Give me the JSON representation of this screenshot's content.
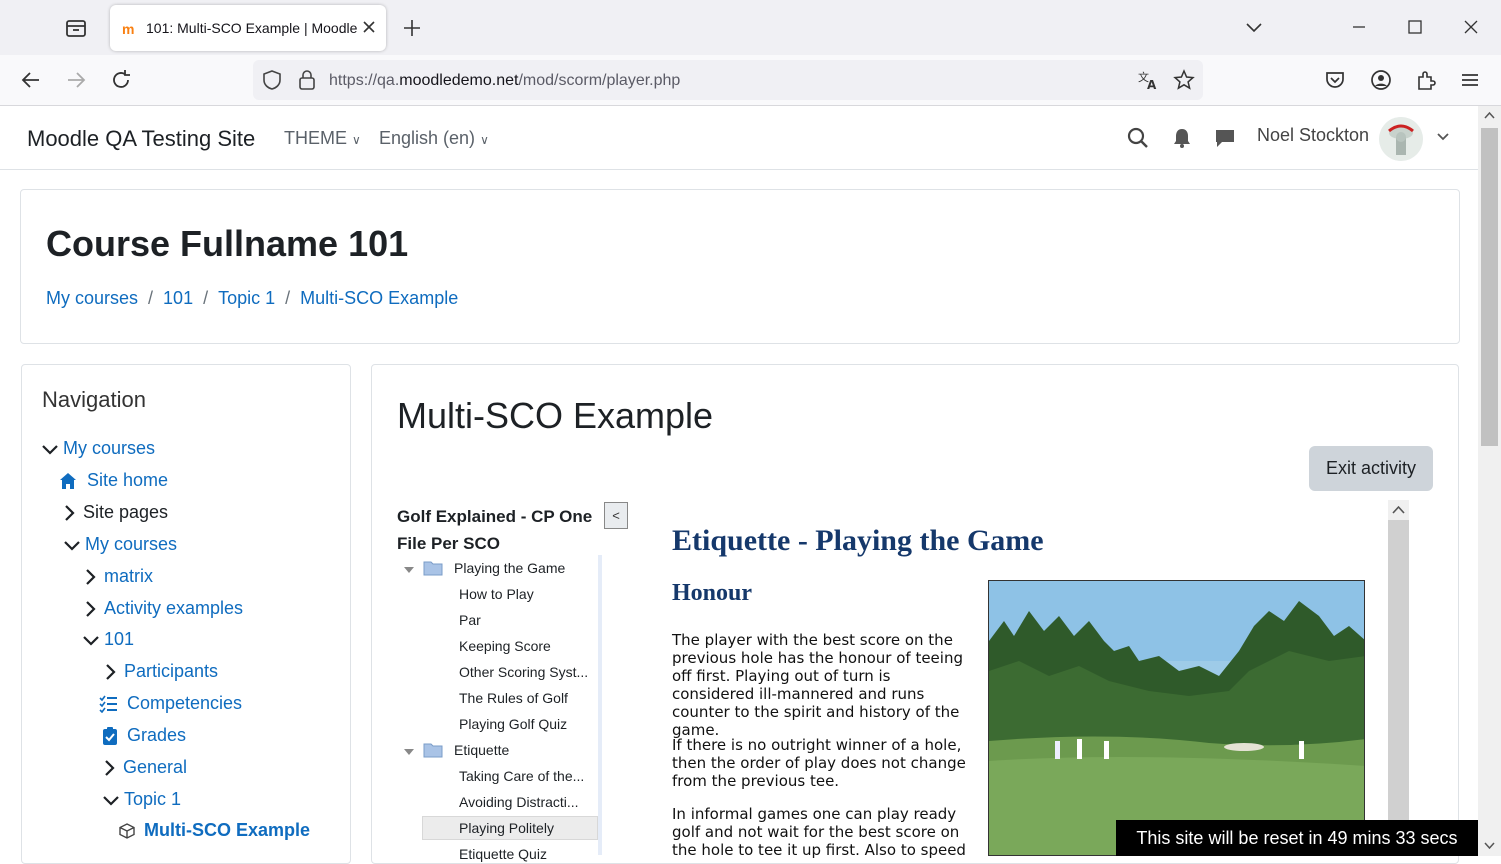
{
  "browser": {
    "tab_title": "101: Multi-SCO Example | Moodle",
    "url_prefix": "https://qa.",
    "url_domain": "moodledemo.net",
    "url_path": "/mod/scorm/player.php"
  },
  "header": {
    "site_name": "Moodle QA Testing Site",
    "theme_label": "THEME",
    "language_label": "English (en)",
    "user_name": "Noel Stockton"
  },
  "page": {
    "course_title": "Course Fullname 101",
    "breadcrumb": [
      "My courses",
      "101",
      "Topic 1",
      "Multi-SCO Example"
    ]
  },
  "navigation": {
    "heading": "Navigation",
    "items": [
      {
        "label": "My courses"
      },
      {
        "label": "Site home"
      },
      {
        "label": "Site pages"
      },
      {
        "label": "My courses"
      },
      {
        "label": "matrix"
      },
      {
        "label": "Activity examples"
      },
      {
        "label": "101"
      },
      {
        "label": "Participants"
      },
      {
        "label": "Competencies"
      },
      {
        "label": "Grades"
      },
      {
        "label": "General"
      },
      {
        "label": "Topic 1"
      },
      {
        "label": "Multi-SCO Example"
      }
    ]
  },
  "main": {
    "activity_title": "Multi-SCO Example",
    "exit_button": "Exit activity",
    "toc_title": "Golf Explained - CP One File Per SCO",
    "toc_toggle": "<",
    "toc": [
      {
        "label": "Playing the Game"
      },
      {
        "label": "How to Play"
      },
      {
        "label": "Par"
      },
      {
        "label": "Keeping Score"
      },
      {
        "label": "Other Scoring Syst..."
      },
      {
        "label": "The Rules of Golf"
      },
      {
        "label": "Playing Golf Quiz"
      },
      {
        "label": "Etiquette"
      },
      {
        "label": "Taking Care of the..."
      },
      {
        "label": "Avoiding Distracti..."
      },
      {
        "label": "Playing Politely"
      },
      {
        "label": "Etiquette Quiz"
      }
    ]
  },
  "sco": {
    "heading": "Etiquette - Playing the Game",
    "subheading": "Honour",
    "paragraphs": [
      "The player with the best score on the previous hole has the honour of teeing off first. Playing out of turn is considered ill-mannered and runs counter to the spirit and history of the game.",
      "If there is no outright winner of a hole, then the order of play does not change from the previous tee.",
      "In informal games one can play ready golf and not wait for the best score on the hole to tee it up first. Also to speed"
    ]
  },
  "banner": {
    "text": "This site will be reset in 49 mins 33 secs"
  },
  "colors": {
    "link": "#0f6cbf",
    "sco_heading": "#15386b"
  }
}
